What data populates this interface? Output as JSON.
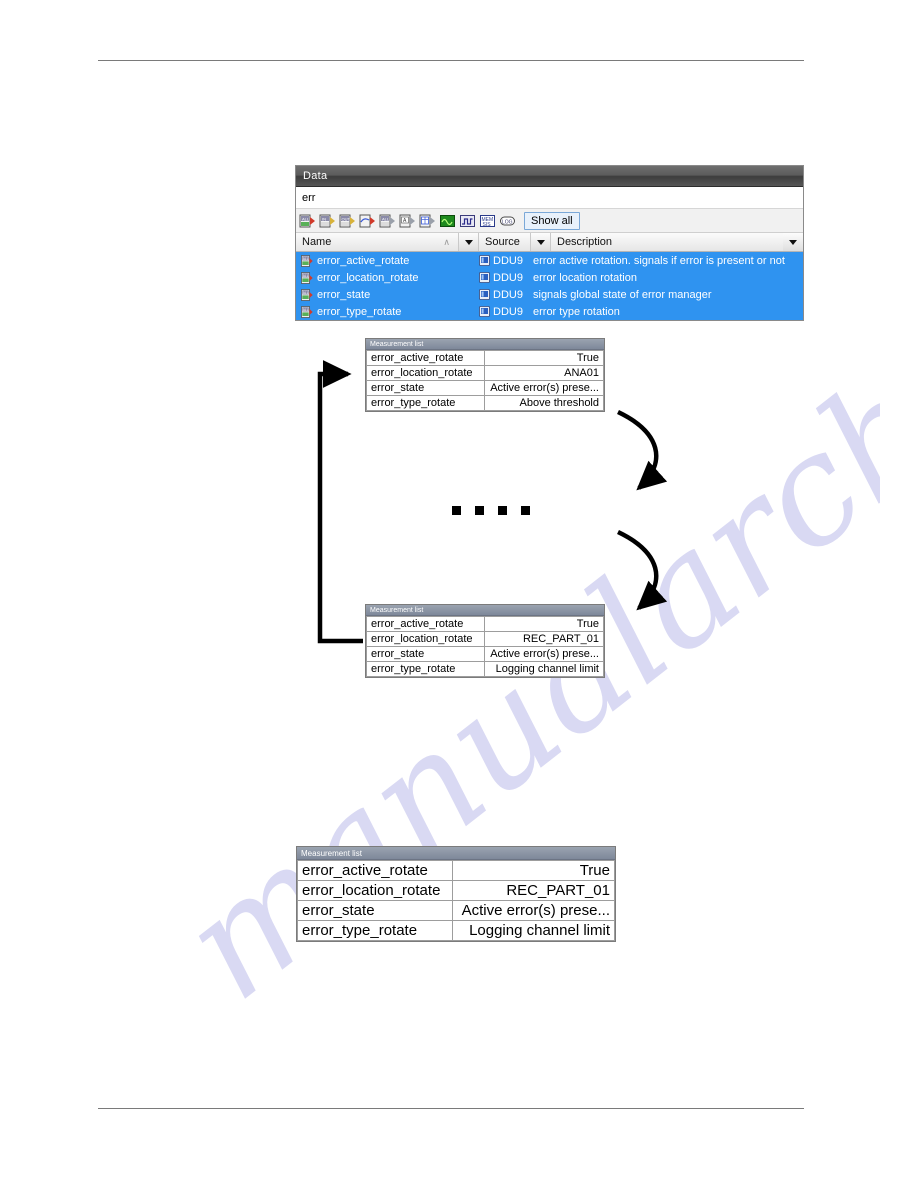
{
  "page": {
    "rules": {
      "top_label": "header-rule",
      "bottom_label": "footer-rule"
    },
    "watermark": "manualarchive.com"
  },
  "data_panel": {
    "title": "Data",
    "filter_value": "err",
    "filter_placeholder": "",
    "toolbar": {
      "icons": [
        "measurement-channel-icon",
        "input-channel-icon",
        "output-channel-icon",
        "curve-channel-icon",
        "calculated-channel-icon",
        "analog-channel-icon",
        "table-channel-icon",
        "waveform-icon",
        "digital-signal-icon",
        "memory-icon",
        "log-icon"
      ],
      "show_all_label": "Show all"
    },
    "columns": [
      {
        "label": "Name",
        "sort_indicator": "∧"
      },
      {
        "label": "Source"
      },
      {
        "label": "Description"
      }
    ],
    "rows": [
      {
        "icon": "measurement-signal-icon",
        "name": "error_active_rotate",
        "source_icon": "device-icon",
        "source": "DDU9",
        "description": "error active rotation. signals if error is present or not",
        "selected": true
      },
      {
        "icon": "measurement-signal-icon",
        "name": "error_location_rotate",
        "source_icon": "device-icon",
        "source": "DDU9",
        "description": "error location rotation",
        "selected": true
      },
      {
        "icon": "measurement-signal-icon",
        "name": "error_state",
        "source_icon": "device-icon",
        "source": "DDU9",
        "description": "signals global state of error manager",
        "selected": true
      },
      {
        "icon": "measurement-signal-icon",
        "name": "error_type_rotate",
        "source_icon": "device-icon",
        "source": "DDU9",
        "description": "error type rotation",
        "selected": true
      }
    ],
    "colors": {
      "selection": "#2f93f0",
      "titlebar": "#4a4a4a",
      "show_all_border": "#7aa8d8"
    }
  },
  "measurement_lists": [
    {
      "id": "top",
      "title": "Measurement list",
      "rows": [
        {
          "key": "error_active_rotate",
          "value": "True"
        },
        {
          "key": "error_location_rotate",
          "value": "ANA01"
        },
        {
          "key": "error_state",
          "value": "Active error(s) prese..."
        },
        {
          "key": "error_type_rotate",
          "value": "Above threshold"
        }
      ]
    },
    {
      "id": "mid",
      "title": "Measurement list",
      "rows": [
        {
          "key": "error_active_rotate",
          "value": "True"
        },
        {
          "key": "error_location_rotate",
          "value": "REC_PART_01"
        },
        {
          "key": "error_state",
          "value": "Active error(s) prese..."
        },
        {
          "key": "error_type_rotate",
          "value": "Logging channel limit"
        }
      ]
    },
    {
      "id": "big",
      "title": "Measurement list",
      "rows": [
        {
          "key": "error_active_rotate",
          "value": "True"
        },
        {
          "key": "error_location_rotate",
          "value": "REC_PART_01"
        },
        {
          "key": "error_state",
          "value": "Active error(s) prese..."
        },
        {
          "key": "error_type_rotate",
          "value": "Logging channel limit"
        }
      ]
    }
  ],
  "diagram": {
    "loop_arrow": "feedback-loop-arrow",
    "curve_arrow_upper": "rotate-arrow-upper",
    "curve_arrow_lower": "rotate-arrow-lower",
    "ellipsis_dots": 4
  }
}
